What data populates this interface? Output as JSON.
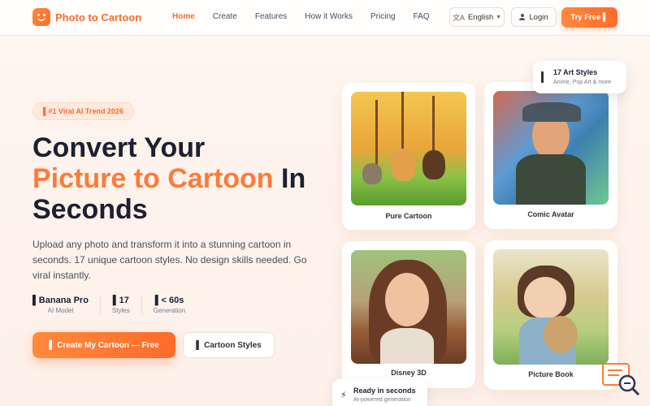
{
  "brand": {
    "name": "Photo to Cartoon",
    "accent": "#ff6a2a"
  },
  "nav": {
    "links": [
      "Home",
      "Create",
      "Features",
      "How it Works",
      "Pricing",
      "FAQ"
    ],
    "active": "Home",
    "language": "English",
    "login": "Login",
    "try_free": "Try Free ▌"
  },
  "hero": {
    "badge": "▌#1 Viral AI Trend 2026",
    "title_line1": "Convert Your",
    "title_highlight": "Picture to Cartoon",
    "title_after": " In",
    "title_line3": "Seconds",
    "description": "Upload any photo and transform it into a stunning cartoon in seconds. 17 unique cartoon styles. No design skills needed. Go viral instantly.",
    "stats": [
      {
        "value": "▌Banana Pro",
        "label": "AI Model"
      },
      {
        "value": "▌17",
        "label": "Styles"
      },
      {
        "value": "▌< 60s",
        "label": "Generation"
      }
    ],
    "cta_primary": "▌ Create My Cartoon — Free",
    "cta_secondary": "▌ Cartoon Styles"
  },
  "styles_panel": {
    "cards": [
      {
        "caption": "Pure Cartoon"
      },
      {
        "caption": "Comic Avatar"
      },
      {
        "caption": "Disney 3D"
      },
      {
        "caption": "Picture Book"
      }
    ],
    "float_top": {
      "title": "17 Art Styles",
      "subtitle": "Anime, Pop Art & more"
    },
    "float_bottom": {
      "title": "Ready in seconds",
      "subtitle": "AI-powered generation"
    }
  }
}
